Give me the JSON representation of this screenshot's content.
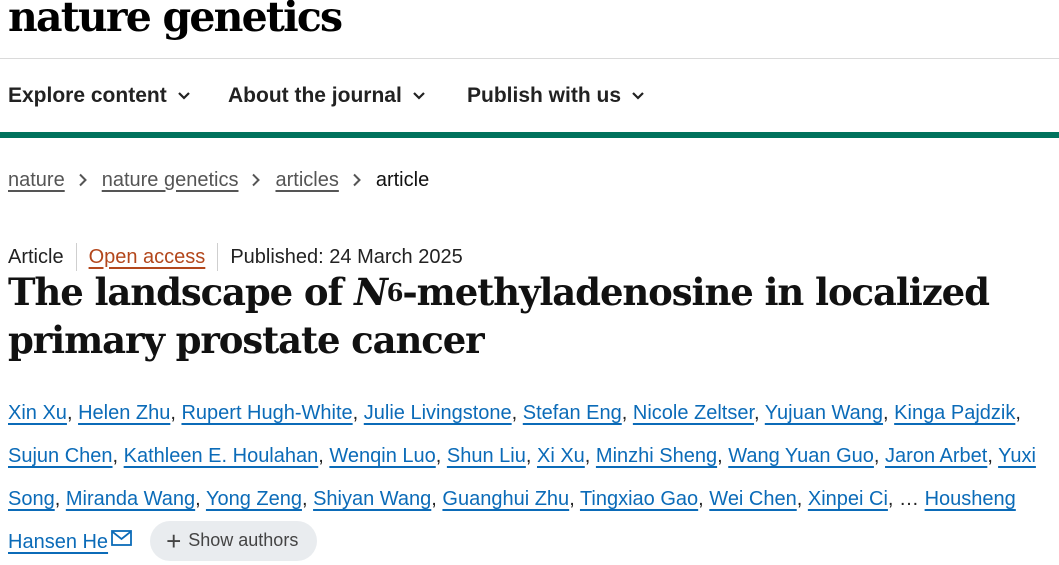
{
  "journal": {
    "logo": "nature genetics"
  },
  "nav": {
    "items": [
      {
        "label": "Explore content"
      },
      {
        "label": "About the journal"
      },
      {
        "label": "Publish with us"
      }
    ]
  },
  "breadcrumb": {
    "items": [
      "nature",
      "nature genetics",
      "articles"
    ],
    "current": "article"
  },
  "article": {
    "type": "Article",
    "access": "Open access",
    "published": "Published: 24 March 2025",
    "title_part1": "The landscape of ",
    "title_italic": "N",
    "title_sup": "6",
    "title_part2": "-methyladenosine in localized primary prostate cancer"
  },
  "authors": {
    "list": [
      "Xin Xu",
      "Helen Zhu",
      "Rupert Hugh-White",
      "Julie Livingstone",
      "Stefan Eng",
      "Nicole Zeltser",
      "Yujuan Wang",
      "Kinga Pajdzik",
      "Sujun Chen",
      "Kathleen E. Houlahan",
      "Wenqin Luo",
      "Shun Liu",
      "Xi Xu",
      "Minzhi Sheng",
      "Wang Yuan Guo",
      "Jaron Arbet",
      "Yuxi Song",
      "Miranda Wang",
      "Yong Zeng",
      "Shiyan Wang",
      "Guanghui Zhu",
      "Tingxiao Gao",
      "Wei Chen",
      "Xinpei Ci"
    ],
    "ellipsis": "…",
    "last": "Housheng Hansen He",
    "show_authors": "Show authors"
  },
  "colors": {
    "accent": "#00725d",
    "link": "#0b6bb8",
    "open_access": "#b3471c"
  },
  "icons": {
    "nav": "chevron-down-icon",
    "breadcrumb": "chevron-right-icon",
    "corresponding": "mail-icon",
    "expand": "plus-icon"
  }
}
